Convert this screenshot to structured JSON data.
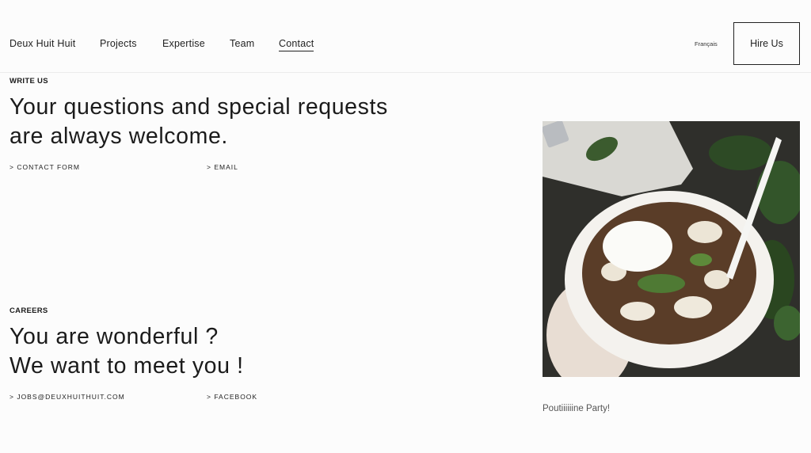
{
  "header": {
    "brand": "Deux Huit Huit",
    "nav": [
      "Projects",
      "Expertise",
      "Team",
      "Contact"
    ],
    "language": "Français",
    "cta": "Hire Us"
  },
  "write_us": {
    "eyebrow": "WRITE US",
    "headline_line1": "Your questions and special requests",
    "headline_line2": "are always welcome.",
    "link_contact": "> CONTACT FORM",
    "link_email": "> EMAIL"
  },
  "careers": {
    "eyebrow": "CAREERS",
    "headline_line1": "You are wonderful ?",
    "headline_line2": "We want to meet you !",
    "link_jobs": "> JOBS@DEUXHUITHUIT.COM",
    "link_facebook": "> FACEBOOK"
  },
  "photo": {
    "caption": "Poutiiiiiine Party!",
    "alt": "poutine-bowl-photo"
  }
}
